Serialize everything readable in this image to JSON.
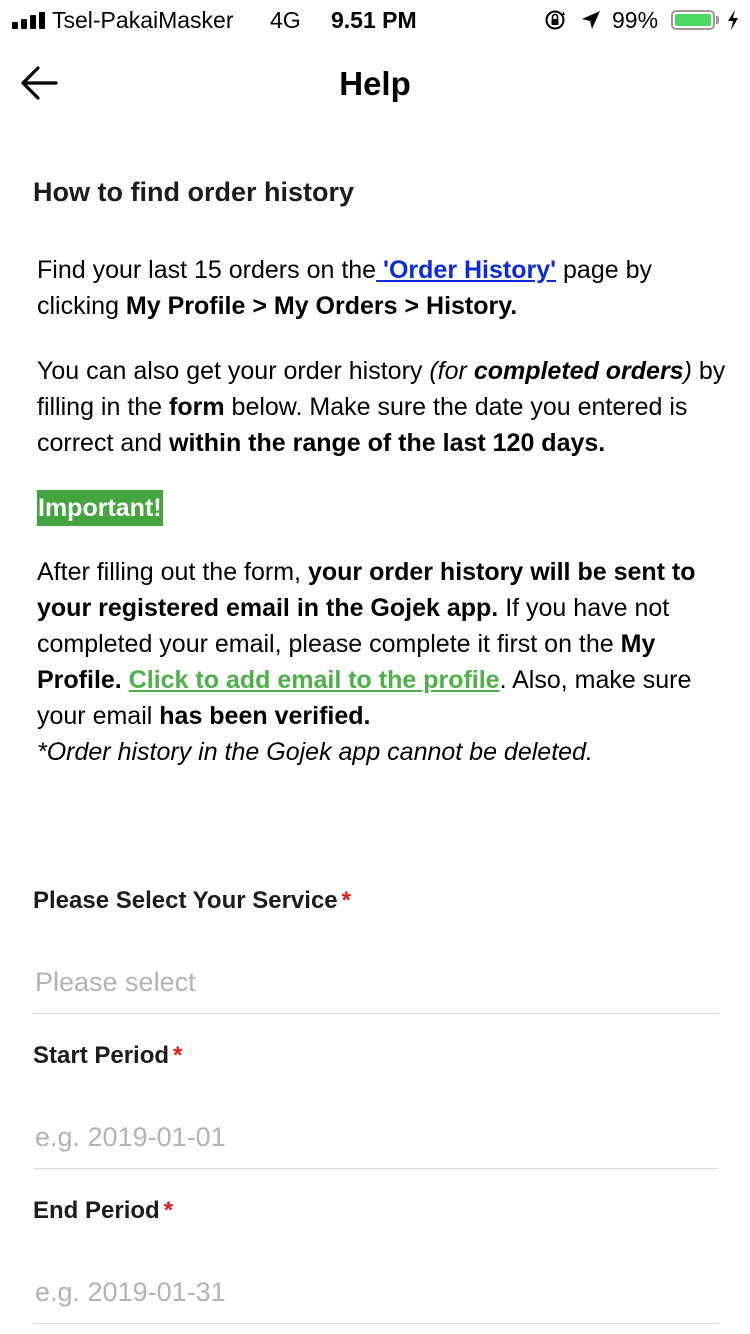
{
  "status_bar": {
    "carrier": "Tsel-PakaiMasker",
    "network": "4G",
    "time": "9.51 PM",
    "battery_percent": "99%",
    "battery_level": 0.99,
    "battery_color": "#4cd964",
    "icons": [
      "signal-icon",
      "orientation-lock-icon",
      "location-arrow-icon",
      "battery-icon",
      "charging-bolt-icon"
    ]
  },
  "header": {
    "title": "Help",
    "back_icon": "arrow-left-icon"
  },
  "article": {
    "heading": "How to find order history",
    "p1": {
      "t1": "Find your last 15 orders on the",
      "link": " 'Order History'",
      "t2": " page by clicking ",
      "bold": "My Profile > My Orders > History."
    },
    "p2": {
      "t1": "You can also get your order history ",
      "i1": "(for ",
      "bi": "completed orders",
      "i2": ")",
      "t2": " by filling in the ",
      "b1": "form",
      "t3": " below. Make sure the date you entered is correct and ",
      "b2": "within the range of the last 120 days."
    },
    "important": "Important!",
    "p3": {
      "t1": "After filling out the form, ",
      "b1": "your order history will be sent to your registered email in the Gojek app.",
      "t2": " If you have not completed your email, please complete it first on the ",
      "b2": "My Profile.",
      "t3": " ",
      "link": "Click to add email to the profile",
      "t4": ". Also, make sure your email ",
      "b3": "has been verified.",
      "note": "*Order history in the Gojek app cannot be deleted."
    }
  },
  "form": {
    "service": {
      "label": "Please Select Your Service",
      "required": "*",
      "placeholder": "Please select"
    },
    "start": {
      "label": "Start Period",
      "required": "*",
      "placeholder": "e.g. 2019-01-01"
    },
    "end": {
      "label": "End Period",
      "required": "*",
      "placeholder": "e.g. 2019-01-31"
    }
  },
  "colors": {
    "link_blue": "#0d2bd6",
    "link_green": "#4fb04a",
    "important_bg": "#45a43f",
    "required_red": "#e01919"
  }
}
